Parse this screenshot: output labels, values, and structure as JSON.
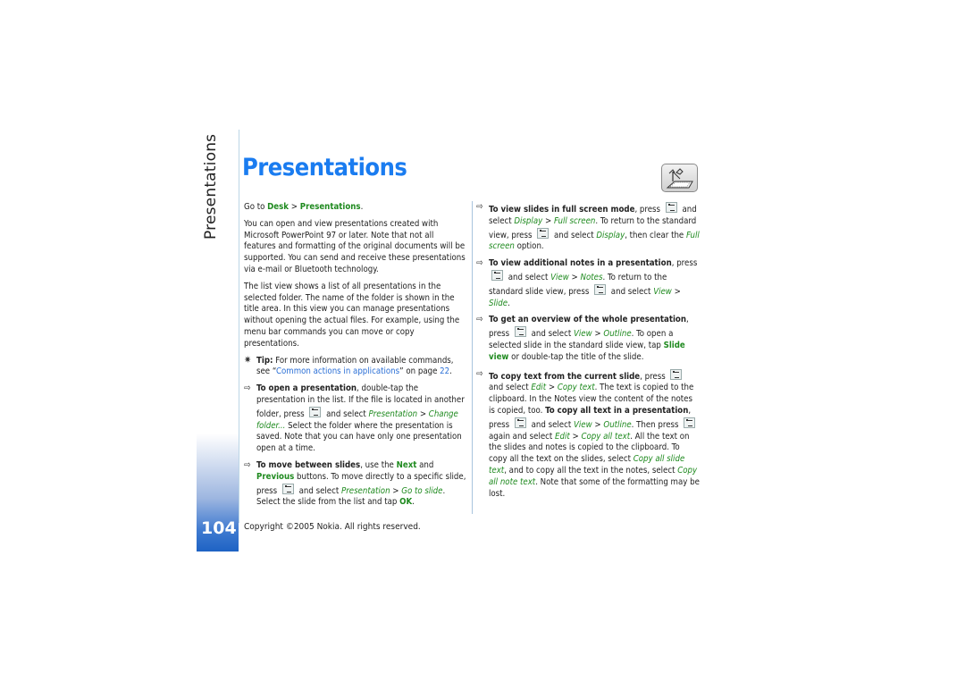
{
  "side_title": "Presentations",
  "title": "Presentations",
  "page_number": "104",
  "copyright": "Copyright ©2005 Nokia. All rights reserved.",
  "app_icon": "presentations-projector-icon",
  "left": {
    "goto": {
      "prefix": "Go to ",
      "desk": "Desk",
      "sep": " > ",
      "target": "Presentations",
      "end": "."
    },
    "para1": "You can open and view presentations created with Microsoft PowerPoint 97 or later. Note that not all features and formatting of the original documents will be supported. You can send and receive these presentations via e-mail or Bluetooth technology.",
    "para2": "The list view shows a list of all presentations in the selected folder. The name of the folder is shown in the title area. In this view you can manage presentations without opening the actual files. For example, using the menu bar commands you can move or copy presentations.",
    "tip": {
      "label": "Tip:",
      "text": " For more information on available commands, see “",
      "link": "Common actions in applications",
      "after": "” on page ",
      "page": "22",
      "end": "."
    },
    "open": {
      "bold": "To open a presentation",
      "t1": ", double-tap the presentation in the list. If the file is located in another folder, press ",
      "t2": " and select ",
      "i1": "Presentation",
      "sep": " > ",
      "i2": "Change folder...",
      "t3": " Select the folder where the presentation is saved. Note that you can have only one presentation open at a time."
    },
    "move": {
      "bold": "To move between slides",
      "t1": ", use the ",
      "next": "Next",
      "and": " and ",
      "prev": "Previous",
      "t2": " buttons. To move directly to a specific slide, press ",
      "t3": " and select ",
      "i1": "Presentation",
      "sep": " > ",
      "i2": "Go to slide",
      "t4": ". Select the slide from the list and tap ",
      "ok": "OK",
      "end": "."
    }
  },
  "right": {
    "full": {
      "bold": "To view slides in full screen mode",
      "t1": ", press ",
      "t2": " and select ",
      "i1": "Display",
      "sep": " > ",
      "i2": "Full screen",
      "t3": ". To return to the standard view, press ",
      "t4": " and select ",
      "i3": "Display",
      "t5": ", then clear the ",
      "i4": "Full screen",
      "t6": " option."
    },
    "notes": {
      "bold": "To view additional notes in a presentation",
      "t1": ", press ",
      "t2": " and select ",
      "i1": "View",
      "sep": " > ",
      "i2": "Notes",
      "t3": ". To return to the standard slide view, press ",
      "t4": " and select ",
      "i3": "View",
      "sep2": " > ",
      "i4": "Slide",
      "end": "."
    },
    "overview": {
      "bold": "To get an overview of the whole presentation",
      "t1": ", press ",
      "t2": " and select ",
      "i1": "View",
      "sep": " > ",
      "i2": "Outline",
      "t3": ". To open a selected slide in the standard slide view, tap ",
      "slideview": "Slide view",
      "t4": " or double-tap the title of the slide."
    },
    "copy": {
      "bold": "To copy text from the current slide",
      "t1": ", press ",
      "t2": " and select ",
      "i1": "Edit",
      "sep": " > ",
      "i2": "Copy text",
      "t3": ". The text is copied to the clipboard. In the Notes view the content of the notes is copied, too. ",
      "bold2": "To copy all text in a presentation",
      "t4": ", press ",
      "t5": " and select ",
      "i3": "View",
      "sep2": " > ",
      "i4": "Outline",
      "t6": ". Then press ",
      "t7": " again and select ",
      "i5": "Edit",
      "sep3": " > ",
      "i6": "Copy all text",
      "t8": ". All the text on the slides and notes is copied to the clipboard. To copy all the text on the slides, select ",
      "i7": "Copy all slide text",
      "t9": ", and to copy all the text in the notes, select ",
      "i8": "Copy all note text",
      "t10": ". Note that some of the formatting may be lost."
    }
  }
}
